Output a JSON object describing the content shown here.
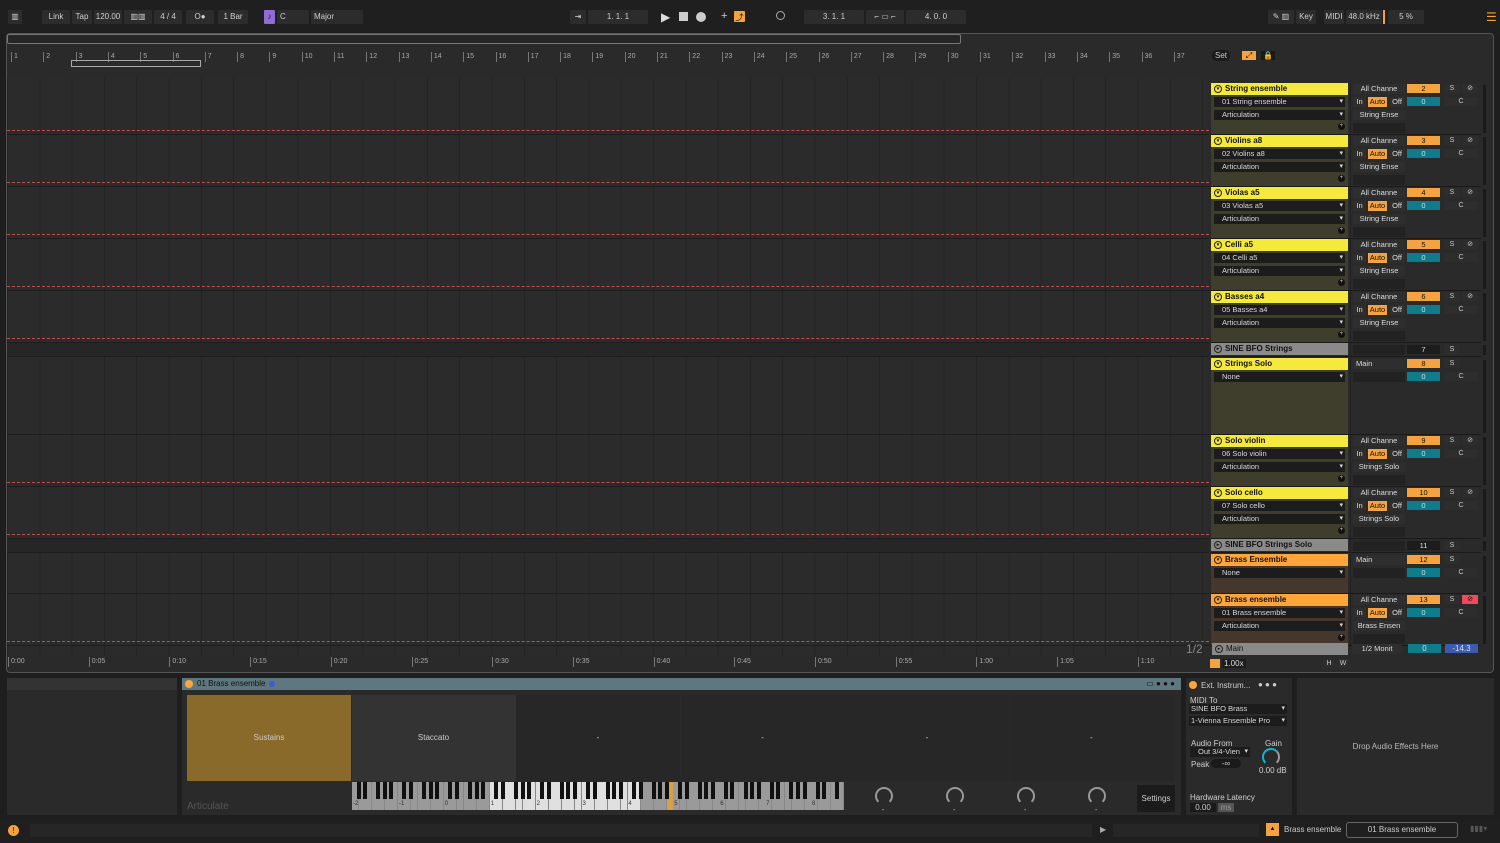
{
  "colors": {
    "yellow": "#f5ea3b",
    "orange": "#ffa53a",
    "accent": "#f4a340",
    "teal": "#0f7c8c",
    "purple": "#8f6cd6",
    "clip": "#5f7880"
  },
  "transport": {
    "link": "Link",
    "tap": "Tap",
    "tempo": "120.00",
    "time_sig": "4 / 4",
    "metronome": "O●",
    "quantize": "1 Bar",
    "key": "C",
    "scale": "Major",
    "position": "1.  1.  1",
    "loop_start": "3.  1.  1",
    "loop_length": "4.  0.  0",
    "key_label": "Key",
    "midi_label": "MIDI",
    "sample_rate": "48.0 kHz",
    "cpu": "5 %"
  },
  "ruler": {
    "bars": [
      "1",
      "2",
      "3",
      "4",
      "5",
      "6",
      "7",
      "8",
      "9",
      "10",
      "11",
      "12",
      "13",
      "14",
      "15",
      "16",
      "17",
      "18",
      "19",
      "20",
      "21",
      "22",
      "23",
      "24",
      "25",
      "26",
      "27",
      "28",
      "29",
      "30",
      "31",
      "32",
      "33",
      "34",
      "35",
      "36",
      "37"
    ],
    "seconds": [
      "0:00",
      "0:05",
      "0:10",
      "0:15",
      "0:20",
      "0:25",
      "0:30",
      "0:35",
      "0:40",
      "0:45",
      "0:50",
      "0:55",
      "1:00",
      "1:05",
      "1:10"
    ],
    "set_label": "Set",
    "page": "1/2"
  },
  "tracks": [
    {
      "name": "String ensemble",
      "type": "midi",
      "color": "yellow",
      "device": "01 String ensemble",
      "chain": "Articulation",
      "input": "All Channe",
      "in": "In",
      "auto": "Auto",
      "off": "Off",
      "output": "String Ense",
      "number": "2",
      "vol": "0",
      "s": "S",
      "c": "C"
    },
    {
      "name": "Violins a8",
      "type": "midi",
      "color": "yellow",
      "device": "02 Violins a8",
      "chain": "Articulation",
      "input": "All Channe",
      "in": "In",
      "auto": "Auto",
      "off": "Off",
      "output": "String Ense",
      "number": "3",
      "vol": "0",
      "s": "S",
      "c": "C"
    },
    {
      "name": "Violas a5",
      "type": "midi",
      "color": "yellow",
      "device": "03 Violas a5",
      "chain": "Articulation",
      "input": "All Channe",
      "in": "In",
      "auto": "Auto",
      "off": "Off",
      "output": "String Ense",
      "number": "4",
      "vol": "0",
      "s": "S",
      "c": "C"
    },
    {
      "name": "Celli a5",
      "type": "midi",
      "color": "yellow",
      "device": "04 Celli a5",
      "chain": "Articulation",
      "input": "All Channe",
      "in": "In",
      "auto": "Auto",
      "off": "Off",
      "output": "String Ense",
      "number": "5",
      "vol": "0",
      "s": "S",
      "c": "C"
    },
    {
      "name": "Basses a4",
      "type": "midi",
      "color": "yellow",
      "device": "05 Basses a4",
      "chain": "Articulation",
      "input": "All Channe",
      "in": "In",
      "auto": "Auto",
      "off": "Off",
      "output": "String Ense",
      "number": "6",
      "vol": "0",
      "s": "S",
      "c": "C"
    },
    {
      "name": "SINE BFO Strings",
      "type": "collapsed",
      "color": "gray",
      "number": "7",
      "s": "S"
    },
    {
      "name": "Strings Solo",
      "type": "group",
      "color": "yellow",
      "device": "None",
      "output": "Main",
      "number": "8",
      "vol": "0",
      "s": "S",
      "c": "C"
    },
    {
      "name": "Solo violin",
      "type": "midi",
      "color": "yellow",
      "device": "06 Solo violin",
      "chain": "Articulation",
      "input": "All Channe",
      "in": "In",
      "auto": "Auto",
      "off": "Off",
      "output": "Strings Solo",
      "number": "9",
      "vol": "0",
      "s": "S",
      "c": "C"
    },
    {
      "name": "Solo cello",
      "type": "midi",
      "color": "yellow",
      "device": "07 Solo cello",
      "chain": "Articulation",
      "input": "All Channe",
      "in": "In",
      "auto": "Auto",
      "off": "Off",
      "output": "Strings Solo",
      "number": "10",
      "vol": "0",
      "s": "S",
      "c": "C"
    },
    {
      "name": "SINE BFO Strings Solo",
      "type": "collapsed",
      "color": "gray",
      "number": "11",
      "s": "S"
    },
    {
      "name": "Brass Ensemble",
      "type": "group2",
      "color": "orange",
      "device": "None",
      "output": "Main",
      "number": "12",
      "vol": "0",
      "s": "S",
      "c": "C"
    },
    {
      "name": "Brass ensemble",
      "type": "midi",
      "color": "orange",
      "armed": true,
      "device": "01 Brass ensemble",
      "chain": "Articulation",
      "input": "All Channe",
      "in": "In",
      "auto": "Auto",
      "off": "Off",
      "output": "Brass Ensen",
      "number": "13",
      "vol": "0",
      "s": "S",
      "c": "C"
    }
  ],
  "main": {
    "name": "Main",
    "output": "1/2 Monit",
    "vol": "0",
    "pan": "-14.3",
    "zoom": "1.00x",
    "h": "H",
    "w": "W"
  },
  "clip": {
    "title": "01 Brass ensemble",
    "pads": [
      "Sustains",
      "Staccato",
      "-",
      "-",
      "-",
      "-"
    ],
    "brand": "Articulate",
    "octaves": [
      "-2",
      "-1",
      "0",
      "1",
      "2",
      "3",
      "4",
      "5",
      "6",
      "7",
      "8"
    ],
    "knob_values": [
      "-",
      "-",
      "-",
      "-"
    ],
    "settings": "Settings"
  },
  "ext_instrument": {
    "title": "Ext. Instrum...",
    "midi_to_label": "MIDI To",
    "midi_to": "SINE BFO Brass",
    "midi_to_port": "1-Vienna Ensemble Pro",
    "audio_from_label": "Audio From",
    "audio_from": "Out 3/4-Vien",
    "gain_label": "Gain",
    "gain": "0.00 dB",
    "peak_label": "Peak",
    "peak": "-∞",
    "latency_label": "Hardware Latency",
    "latency": "0.00",
    "latency_unit": "ms"
  },
  "drop_text": "Drop Audio Effects Here",
  "status": {
    "track": "Brass ensemble",
    "device": "01 Brass ensemble"
  }
}
